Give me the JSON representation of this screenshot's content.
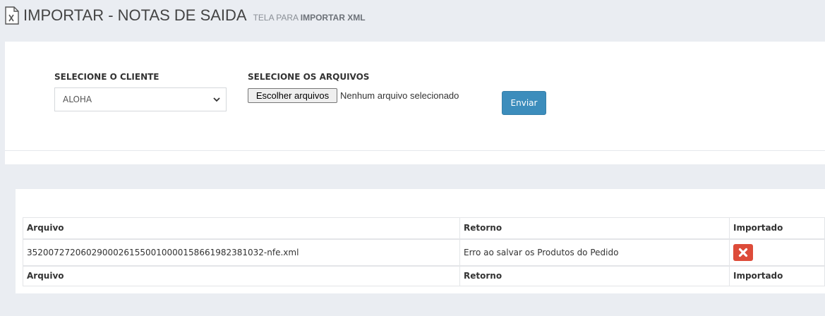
{
  "header": {
    "title": "IMPORTAR - NOTAS DE SAIDA",
    "subtitle_prefix": "TELA PARA",
    "subtitle_strong": "IMPORTAR XML"
  },
  "form": {
    "client_label": "SELECIONE O CLIENTE",
    "client_selected": "ALOHA",
    "files_label": "SELECIONE OS ARQUIVOS",
    "choose_files_label": "Escolher arquivos",
    "no_file_text": "Nenhum arquivo selecionado",
    "send_label": "Enviar"
  },
  "table": {
    "headers": [
      "Arquivo",
      "Retorno",
      "Importado"
    ],
    "rows": [
      {
        "arquivo": "35200727206029000261550010000158661982381032-nfe.xml",
        "retorno": "Erro ao salvar os Produtos do Pedido",
        "importado": "error-x-icon"
      }
    ],
    "footers": [
      "Arquivo",
      "Retorno",
      "Importado"
    ]
  },
  "colors": {
    "primary_button": "#3c8dbc",
    "error_badge": "#dd4b39",
    "background": "#eaedf2"
  }
}
